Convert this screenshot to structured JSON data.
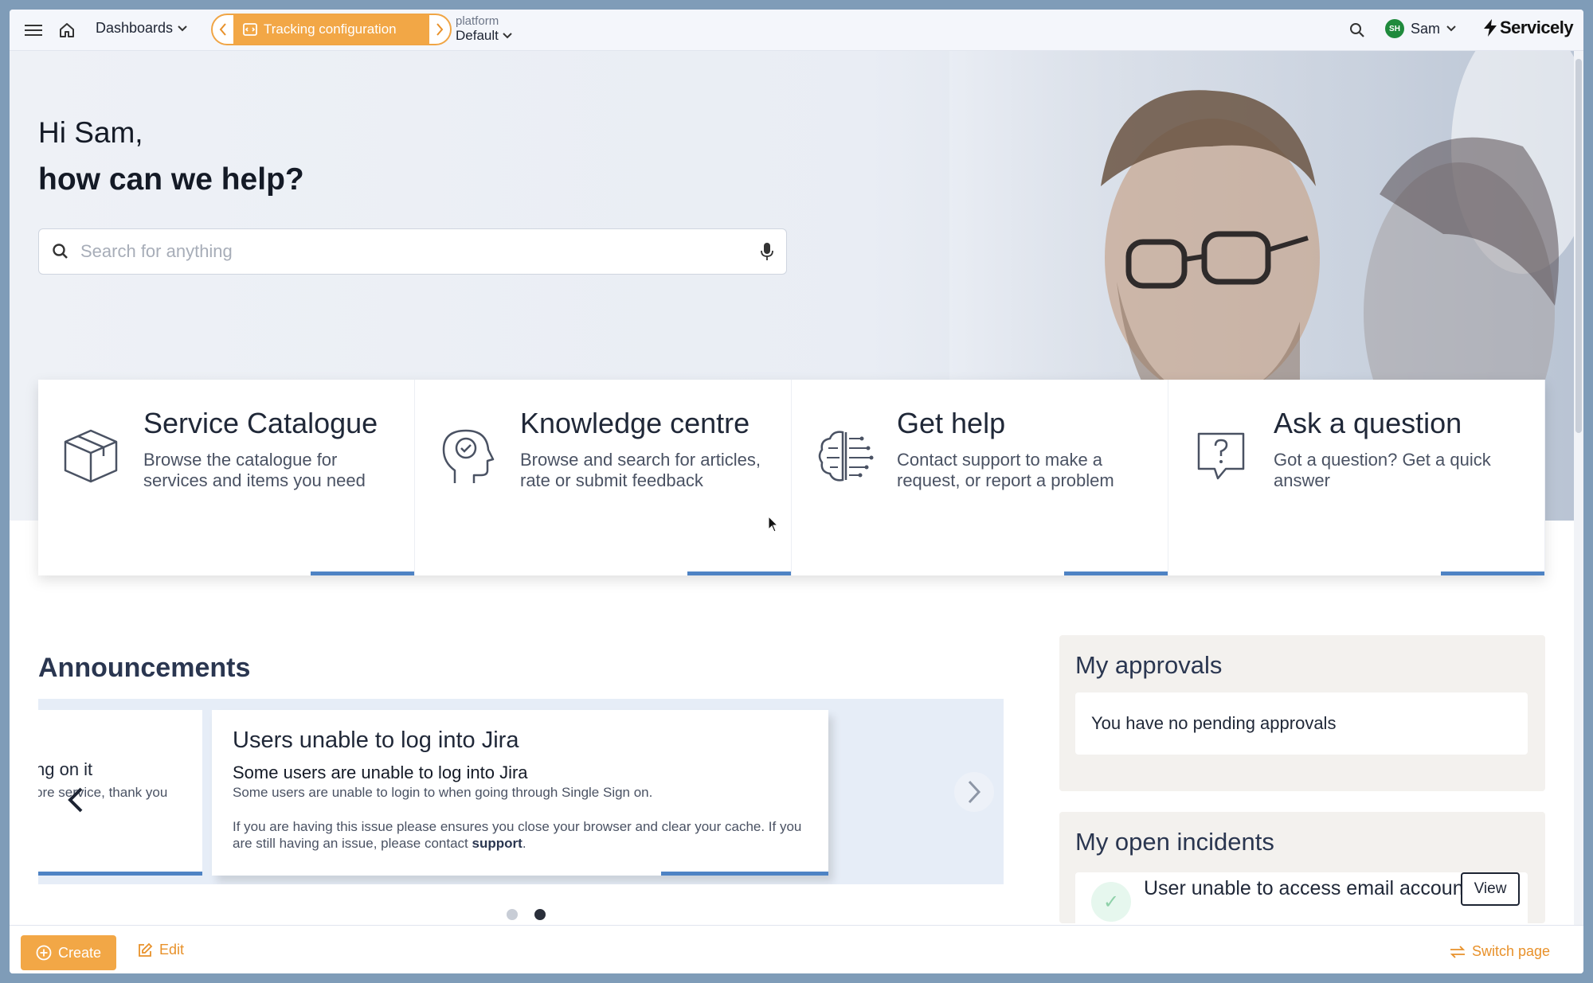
{
  "topbar": {
    "dashboards_label": "Dashboards",
    "tracking_label": "Tracking configuration",
    "platform_small": "platform",
    "platform_value": "Default",
    "user_initials": "SH",
    "user_name": "Sam",
    "brand": "Servicely"
  },
  "hero": {
    "greeting": "Hi Sam,",
    "question": "how can we help?",
    "search_placeholder": "Search for anything"
  },
  "cards": [
    {
      "title": "Service Catalogue",
      "desc": "Browse the catalogue for services and items you need",
      "icon": "box-icon"
    },
    {
      "title": "Knowledge centre",
      "desc": "Browse and search for articles, rate or submit feedback",
      "icon": "head-check-icon"
    },
    {
      "title": "Get help",
      "desc": "Contact support to make a request, or report a problem",
      "icon": "brain-icon"
    },
    {
      "title": "Ask a question",
      "desc": "Got a question? Get a quick answer",
      "icon": "question-bubble-icon"
    }
  ],
  "announcements": {
    "title": "Announcements",
    "prev_slide": {
      "line1": "ng on it",
      "line2": "ore service, thank you"
    },
    "slide": {
      "title": "Users unable to log into Jira",
      "subtitle": "Some users are unable to log into Jira",
      "body1": "Some users are unable to login to when going through Single Sign on.",
      "body2": "If you are having this issue please ensures you close your browser and clear your cache.  If you are still having an issue, please contact",
      "body2_link": "support",
      "body2_end": "."
    },
    "dots": 2,
    "active_dot": 2
  },
  "approvals": {
    "title": "My approvals",
    "empty": "You have no pending approvals"
  },
  "incidents": {
    "title": "My open incidents",
    "item_text": "User unable to access email account due to password reset issues",
    "view_label": "View"
  },
  "bottombar": {
    "create_label": "Create",
    "edit_label": "Edit",
    "switch_label": "Switch page"
  },
  "colors": {
    "accent": "#f2a746",
    "link": "#e8912a",
    "bar": "#4e83c4"
  }
}
